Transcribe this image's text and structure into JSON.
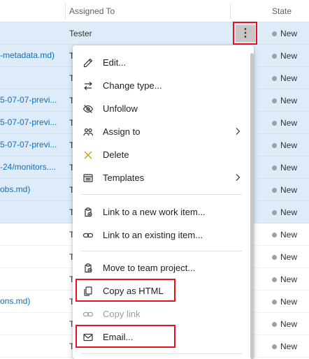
{
  "header": {
    "assigned_to": "Assigned To",
    "state": "State"
  },
  "rows": [
    {
      "title": "",
      "assignee": "Tester",
      "state": "New"
    },
    {
      "title": "-metadata.md)",
      "assignee": "T",
      "state": "New"
    },
    {
      "title": "",
      "assignee": "T",
      "state": "New"
    },
    {
      "title": "5-07-07-previ...",
      "assignee": "T",
      "state": "New"
    },
    {
      "title": "5-07-07-previ...",
      "assignee": "T",
      "state": "New"
    },
    {
      "title": "5-07-07-previ...",
      "assignee": "T",
      "state": "New"
    },
    {
      "title": "-24/monitors....",
      "assignee": "T",
      "state": "New"
    },
    {
      "title": "obs.md)",
      "assignee": "T",
      "state": "New"
    },
    {
      "title": "",
      "assignee": "T",
      "state": "New"
    },
    {
      "title": "",
      "assignee": "T",
      "state": "New"
    },
    {
      "title": "",
      "assignee": "T",
      "state": "New"
    },
    {
      "title": "",
      "assignee": "T",
      "state": "New"
    },
    {
      "title": "ons.md)",
      "assignee": "T",
      "state": "New"
    },
    {
      "title": "",
      "assignee": "T",
      "state": "New"
    },
    {
      "title": "",
      "assignee": "T",
      "state": "New"
    },
    {
      "title": "",
      "assignee": "T",
      "state": "New"
    }
  ],
  "menu": {
    "edit": "Edit...",
    "change_type": "Change type...",
    "unfollow": "Unfollow",
    "assign_to": "Assign to",
    "delete": "Delete",
    "templates": "Templates",
    "link_new": "Link to a new work item...",
    "link_existing": "Link to an existing item...",
    "move_project": "Move to team project...",
    "copy_html": "Copy as HTML",
    "copy_link": "Copy link",
    "email": "Email..."
  },
  "colors": {
    "selected_row": "#deecf9",
    "highlight": "#e81123",
    "link": "#106ebe"
  }
}
